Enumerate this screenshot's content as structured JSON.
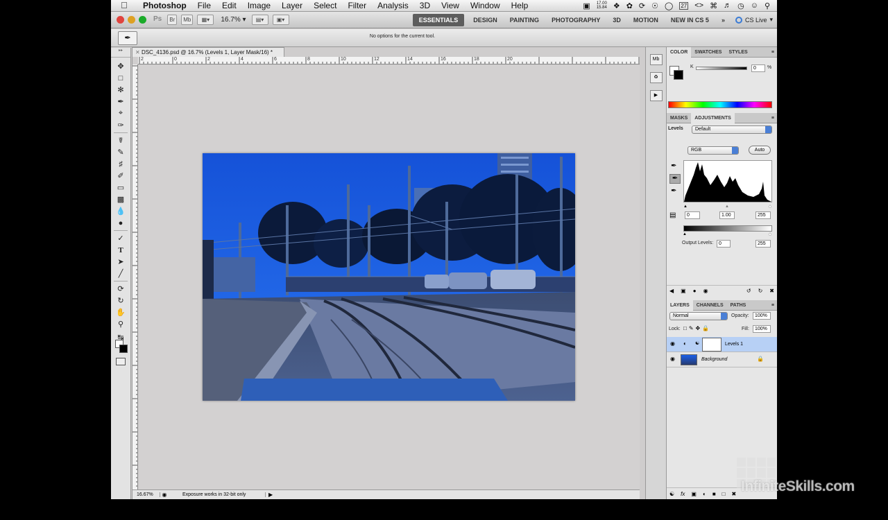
{
  "menubar": {
    "app_name": "Photoshop",
    "items": [
      "File",
      "Edit",
      "Image",
      "Layer",
      "Select",
      "Filter",
      "Analysis",
      "3D",
      "View",
      "Window",
      "Help"
    ],
    "clock_top": "17.00",
    "clock_bottom": "15.84",
    "tray_number": "27"
  },
  "appbar": {
    "ps_label": "Ps",
    "br_label": "Br",
    "mb_label": "Mb",
    "zoom": "16.7%",
    "workspaces": [
      "ESSENTIALS",
      "DESIGN",
      "PAINTING",
      "PHOTOGRAPHY",
      "3D",
      "MOTION",
      "NEW IN CS 5"
    ],
    "more": "»",
    "cslive": "CS Live"
  },
  "options": {
    "message": "No options for the current tool."
  },
  "document": {
    "tab_title": "DSC_4136.psd @ 16.7% (Levels 1, Layer Mask/16) *",
    "ruler_ticks": [
      "2",
      "0",
      "2",
      "4",
      "6",
      "8",
      "10",
      "12",
      "14",
      "16",
      "18",
      "20"
    ],
    "status_zoom": "16.67%",
    "status_info": "Exposure works in 32-bit only"
  },
  "color_panel": {
    "tabs": [
      "COLOR",
      "SWATCHES",
      "STYLES"
    ],
    "channel_label": "K",
    "value": "0",
    "unit": "%"
  },
  "adjustments": {
    "tabs": [
      "MASKS",
      "ADJUSTMENTS"
    ],
    "preset_label": "Levels",
    "preset_value": "Default",
    "channel": "RGB",
    "auto_label": "Auto",
    "input_black": "0",
    "input_gamma": "1.00",
    "input_white": "255",
    "output_label": "Output Levels:",
    "output_black": "0",
    "output_white": "255"
  },
  "layers": {
    "tabs": [
      "LAYERS",
      "CHANNELS",
      "PATHS"
    ],
    "blend_mode": "Normal",
    "opacity_label": "Opacity:",
    "opacity": "100%",
    "lock_label": "Lock:",
    "fill_label": "Fill:",
    "fill": "100%",
    "rows": [
      {
        "name": "Levels 1",
        "selected": true
      },
      {
        "name": "Background",
        "selected": false
      }
    ]
  },
  "watermark": "InfiniteSkills.com",
  "colors": {
    "accent": "#4a7fd6",
    "selected_layer": "#b7d0f5",
    "image_sky": "#1b5fe8"
  }
}
